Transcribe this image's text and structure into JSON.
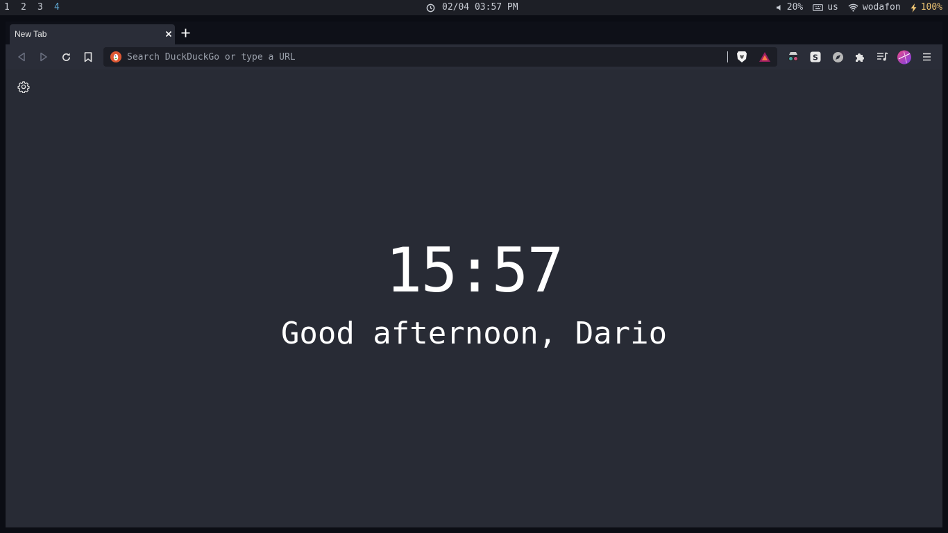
{
  "system_bar": {
    "workspaces": [
      "1",
      "2",
      "3",
      "4"
    ],
    "active_workspace": "4",
    "datetime": "02/04 03:57 PM",
    "volume": "20%",
    "keyboard_layout": "us",
    "wifi_network": "wodafon",
    "battery": "100%"
  },
  "browser": {
    "tab": {
      "title": "New Tab"
    },
    "urlbar": {
      "placeholder": "Search DuckDuckGo or type a URL",
      "value": ""
    }
  },
  "newtab_page": {
    "time": "15:57",
    "greeting": "Good afternoon, Dario"
  },
  "colors": {
    "accent": "#5fa8d3",
    "battery": "#f0c674",
    "duckduckgo": "#de5833",
    "page_bg": "#282b35"
  }
}
